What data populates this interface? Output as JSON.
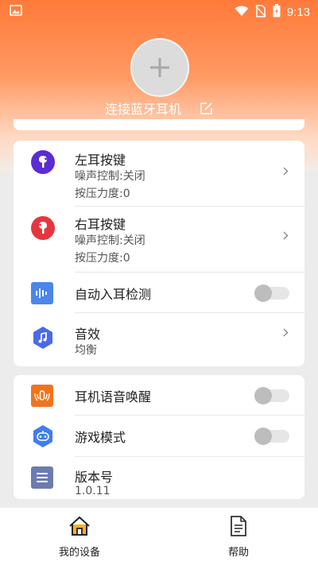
{
  "status_bar": {
    "time": "9:13"
  },
  "header": {
    "connect_label": "连接蓝牙耳机"
  },
  "card1": {
    "left_key": {
      "title": "左耳按键",
      "line1": "噪声控制:关闭",
      "line2": "按压力度:0"
    },
    "right_key": {
      "title": "右耳按键",
      "line1": "噪声控制:关闭",
      "line2": "按压力度:0"
    },
    "auto_ear": {
      "title": "自动入耳检测"
    },
    "sound_effect": {
      "title": "音效",
      "value": "均衡"
    }
  },
  "card2": {
    "voice_wake": {
      "title": "耳机语音唤醒"
    },
    "game_mode": {
      "title": "游戏模式"
    },
    "version": {
      "title": "版本号",
      "value": "1.0.11"
    }
  },
  "bottom_nav": {
    "my_device": "我的设备",
    "help": "帮助"
  },
  "colors": {
    "header_orange": "#ff7a3a",
    "left_icon": "#5b2bd6",
    "right_icon": "#e5363e",
    "blue_icon": "#4a86ec",
    "orange_icon": "#f0741f",
    "grey_icon": "#6b7cb0"
  }
}
